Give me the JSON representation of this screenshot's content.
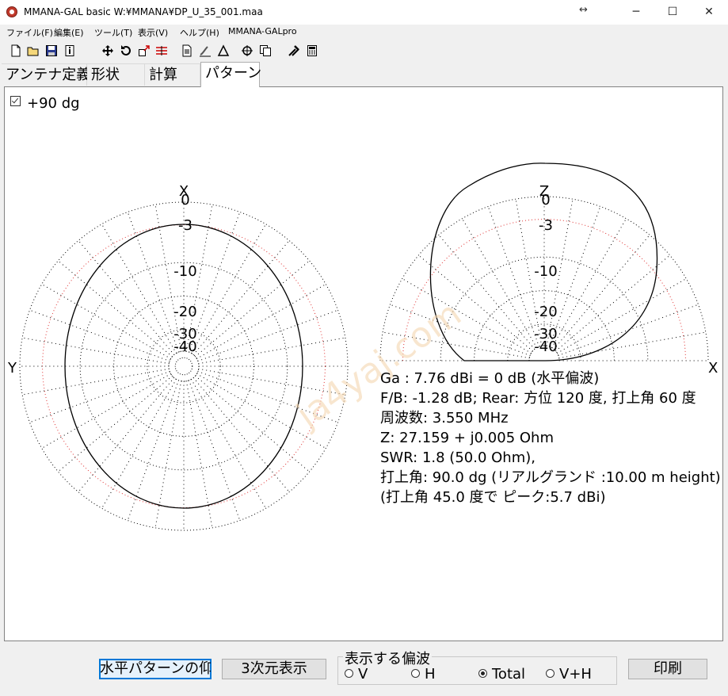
{
  "window": {
    "title": "MMANA-GAL basic W:¥MMANA¥DP_U_35_001.maa",
    "resize_glyph": "↔",
    "minimize": "─",
    "maximize": "☐",
    "close": "✕"
  },
  "menu": [
    "ファイル(F)",
    "編集(E)",
    "ツール(T)",
    "表示(V)",
    "ヘルプ(H)",
    "MMANA-GALpro"
  ],
  "toolbar": [
    "new-file-icon",
    "open-folder-icon",
    "save-icon",
    "info-icon",
    "move-icon",
    "rotate-icon",
    "resize-icon",
    "segment-icon",
    "document-icon",
    "link-icon",
    "triangle-icon",
    "crosshair-icon",
    "copy-icon",
    "tools-icon",
    "calculator-icon"
  ],
  "tabs": [
    "アンテナ定義",
    "形状",
    "計算",
    "パターン"
  ],
  "active_tab": 3,
  "checkbox": {
    "label": "+90 dg",
    "checked": true
  },
  "plots": {
    "horizontal": {
      "top_label": "X",
      "left_label": "Y",
      "ring_labels": [
        "0",
        "-3",
        "-10",
        "-20",
        "-30",
        "-40"
      ]
    },
    "vertical": {
      "top_label": "Z",
      "right_label": "X",
      "ring_labels": [
        "0",
        "-3",
        "-10",
        "-20",
        "-30",
        "-40"
      ]
    }
  },
  "info_lines": [
    "Ga : 7.76 dBi = 0 dB  (水平偏波)",
    "F/B: -1.28 dB; Rear: 方位 120 度,  打上角 60 度",
    "周波数: 3.550 MHz",
    "Z: 27.159 + j0.005 Ohm",
    "SWR: 1.8 (50.0 Ohm),",
    "打上角: 90.0 dg (リアルグランド  :10.00 m height)",
    "(打上角 45.0 度で ピーク:5.7 dBi)"
  ],
  "bottom": {
    "btn_elevation": "水平パターンの仰角",
    "btn_3d": "3次元表示",
    "group_title": "表示する偏波",
    "radios": [
      {
        "label": "V",
        "selected": false
      },
      {
        "label": "H",
        "selected": false
      },
      {
        "label": "Total",
        "selected": true
      },
      {
        "label": "V+H",
        "selected": false
      }
    ],
    "btn_print": "印刷"
  },
  "colors": {
    "pattern": "#000000",
    "grid": "#000000",
    "ref_ring": "#e03030",
    "watermark": "#f5d6b0"
  }
}
